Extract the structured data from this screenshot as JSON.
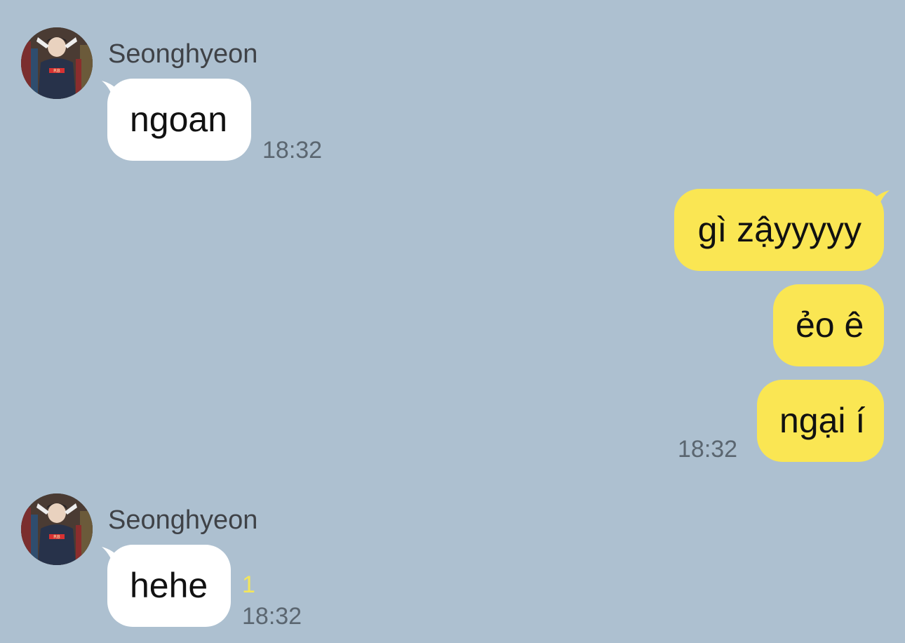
{
  "colors": {
    "background": "#adc0d0",
    "incoming_bubble": "#ffffff",
    "outgoing_bubble": "#fae653",
    "unread_count": "#f4e65a"
  },
  "messages": [
    {
      "direction": "incoming",
      "sender": "Seonghyeon",
      "avatar_icon": "profile-photo",
      "text": "ngoan",
      "time": "18:32"
    },
    {
      "direction": "outgoing",
      "bubbles": [
        "gì zậyyyyy",
        "ẻo ê",
        "ngại í"
      ],
      "time": "18:32"
    },
    {
      "direction": "incoming",
      "sender": "Seonghyeon",
      "avatar_icon": "profile-photo",
      "text": "hehe",
      "unread": "1",
      "time": "18:32"
    }
  ]
}
